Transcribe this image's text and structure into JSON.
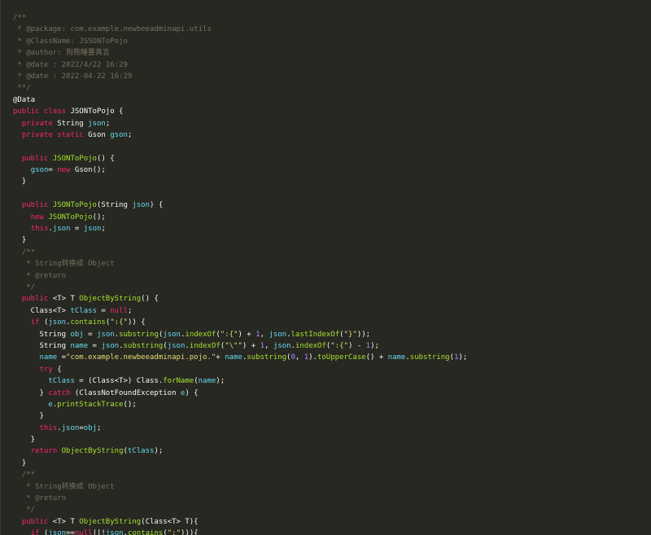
{
  "editor": {
    "lines": [
      [
        [
          "c",
          "/**"
        ]
      ],
      [
        [
          "c",
          " * @package: com.example.newbeeadminapi.utils"
        ]
      ],
      [
        [
          "c",
          " * @ClassName: JSSONToPojo"
        ]
      ],
      [
        [
          "c",
          " * @author: 狗熊睡要真言"
        ]
      ],
      [
        [
          "c",
          " * @date : 2022/4/22 16:29"
        ]
      ],
      [
        [
          "c",
          " * @date : 2022-04-22 16:29"
        ]
      ],
      [
        [
          "c",
          " **/"
        ]
      ],
      [
        [
          "a",
          "@Data"
        ]
      ],
      [
        [
          "k",
          "public class "
        ],
        [
          "p",
          "JSONToPojo {"
        ]
      ],
      [
        [
          "p",
          "  "
        ],
        [
          "k",
          "private "
        ],
        [
          "p",
          "String "
        ],
        [
          "v",
          "json"
        ],
        [
          "p",
          ";"
        ]
      ],
      [
        [
          "p",
          "  "
        ],
        [
          "k",
          "private static "
        ],
        [
          "p",
          "Gson "
        ],
        [
          "v",
          "gson"
        ],
        [
          "p",
          ";"
        ]
      ],
      [],
      [
        [
          "p",
          "  "
        ],
        [
          "k",
          "public "
        ],
        [
          "f",
          "JSONToPojo"
        ],
        [
          "p",
          "() {"
        ]
      ],
      [
        [
          "p",
          "    "
        ],
        [
          "v",
          "gson"
        ],
        [
          "p",
          "= "
        ],
        [
          "k",
          "new "
        ],
        [
          "p",
          "Gson();"
        ]
      ],
      [
        [
          "p",
          "  }"
        ]
      ],
      [],
      [
        [
          "p",
          "  "
        ],
        [
          "k",
          "public "
        ],
        [
          "f",
          "JSONToPojo"
        ],
        [
          "p",
          "(String "
        ],
        [
          "v",
          "json"
        ],
        [
          "p",
          ") {"
        ]
      ],
      [
        [
          "p",
          "    "
        ],
        [
          "k",
          "new "
        ],
        [
          "f",
          "JSONToPojo"
        ],
        [
          "p",
          "();"
        ]
      ],
      [
        [
          "p",
          "    "
        ],
        [
          "k",
          "this"
        ],
        [
          "p",
          "."
        ],
        [
          "v",
          "json"
        ],
        [
          "p",
          " = "
        ],
        [
          "v",
          "json"
        ],
        [
          "p",
          ";"
        ]
      ],
      [
        [
          "p",
          "  }"
        ]
      ],
      [
        [
          "c",
          "  /**"
        ]
      ],
      [
        [
          "c",
          "   * String转换成 Object"
        ]
      ],
      [
        [
          "c",
          "   * @return"
        ]
      ],
      [
        [
          "c",
          "   */"
        ]
      ],
      [
        [
          "p",
          "  "
        ],
        [
          "k",
          "public "
        ],
        [
          "p",
          "<T> T "
        ],
        [
          "f",
          "ObjectByString"
        ],
        [
          "p",
          "() {"
        ]
      ],
      [
        [
          "p",
          "    Class<T> "
        ],
        [
          "v",
          "tClass"
        ],
        [
          "p",
          " = "
        ],
        [
          "k",
          "null"
        ],
        [
          "p",
          ";"
        ]
      ],
      [
        [
          "p",
          "    "
        ],
        [
          "k",
          "if "
        ],
        [
          "p",
          "("
        ],
        [
          "v",
          "json"
        ],
        [
          "p",
          "."
        ],
        [
          "f",
          "contains"
        ],
        [
          "p",
          "("
        ],
        [
          "s",
          "\":{\""
        ],
        [
          "p",
          ")) {"
        ]
      ],
      [
        [
          "p",
          "      String "
        ],
        [
          "v",
          "obj"
        ],
        [
          "p",
          " = "
        ],
        [
          "v",
          "json"
        ],
        [
          "p",
          "."
        ],
        [
          "f",
          "substring"
        ],
        [
          "p",
          "("
        ],
        [
          "v",
          "json"
        ],
        [
          "p",
          "."
        ],
        [
          "f",
          "indexOf"
        ],
        [
          "p",
          "("
        ],
        [
          "s",
          "\":{\""
        ],
        [
          "p",
          ") + "
        ],
        [
          "n",
          "1"
        ],
        [
          "p",
          ", "
        ],
        [
          "v",
          "json"
        ],
        [
          "p",
          "."
        ],
        [
          "f",
          "lastIndexOf"
        ],
        [
          "p",
          "("
        ],
        [
          "s",
          "\"}\""
        ],
        [
          "p",
          "));"
        ]
      ],
      [
        [
          "p",
          "      String "
        ],
        [
          "v",
          "name"
        ],
        [
          "p",
          " = "
        ],
        [
          "v",
          "json"
        ],
        [
          "p",
          "."
        ],
        [
          "f",
          "substring"
        ],
        [
          "p",
          "("
        ],
        [
          "v",
          "json"
        ],
        [
          "p",
          "."
        ],
        [
          "f",
          "indexOf"
        ],
        [
          "p",
          "("
        ],
        [
          "s",
          "\"\\\"\""
        ],
        [
          "p",
          ") + "
        ],
        [
          "n",
          "1"
        ],
        [
          "p",
          ", "
        ],
        [
          "v",
          "json"
        ],
        [
          "p",
          "."
        ],
        [
          "f",
          "indexOf"
        ],
        [
          "p",
          "("
        ],
        [
          "s",
          "\":{\""
        ],
        [
          "p",
          ") - "
        ],
        [
          "n",
          "1"
        ],
        [
          "p",
          ");"
        ]
      ],
      [
        [
          "p",
          "      "
        ],
        [
          "v",
          "name"
        ],
        [
          "p",
          " ="
        ],
        [
          "s",
          "\"com.example.newbeeadminapi.pojo.\""
        ],
        [
          "p",
          "+ "
        ],
        [
          "v",
          "name"
        ],
        [
          "p",
          "."
        ],
        [
          "f",
          "substring"
        ],
        [
          "p",
          "("
        ],
        [
          "n",
          "0"
        ],
        [
          "p",
          ", "
        ],
        [
          "n",
          "1"
        ],
        [
          "p",
          ")."
        ],
        [
          "f",
          "toUpperCase"
        ],
        [
          "p",
          "() + "
        ],
        [
          "v",
          "name"
        ],
        [
          "p",
          "."
        ],
        [
          "f",
          "substring"
        ],
        [
          "p",
          "("
        ],
        [
          "n",
          "1"
        ],
        [
          "p",
          ");"
        ]
      ],
      [
        [
          "p",
          "      "
        ],
        [
          "k",
          "try "
        ],
        [
          "p",
          "{"
        ]
      ],
      [
        [
          "p",
          "        "
        ],
        [
          "v",
          "tClass"
        ],
        [
          "p",
          " = (Class<T>) Class."
        ],
        [
          "f",
          "forName"
        ],
        [
          "p",
          "("
        ],
        [
          "v",
          "name"
        ],
        [
          "p",
          ");"
        ]
      ],
      [
        [
          "p",
          "      } "
        ],
        [
          "k",
          "catch "
        ],
        [
          "p",
          "(ClassNotFoundException "
        ],
        [
          "v",
          "e"
        ],
        [
          "p",
          ") {"
        ]
      ],
      [
        [
          "p",
          "        "
        ],
        [
          "v",
          "e"
        ],
        [
          "p",
          "."
        ],
        [
          "f",
          "printStackTrace"
        ],
        [
          "p",
          "();"
        ]
      ],
      [
        [
          "p",
          "      }"
        ]
      ],
      [
        [
          "p",
          "      "
        ],
        [
          "k",
          "this"
        ],
        [
          "p",
          "."
        ],
        [
          "v",
          "json"
        ],
        [
          "p",
          "="
        ],
        [
          "v",
          "obj"
        ],
        [
          "p",
          ";"
        ]
      ],
      [
        [
          "p",
          "    }"
        ]
      ],
      [
        [
          "p",
          "    "
        ],
        [
          "k",
          "return "
        ],
        [
          "f",
          "ObjectByString"
        ],
        [
          "p",
          "("
        ],
        [
          "v",
          "tClass"
        ],
        [
          "p",
          ");"
        ]
      ],
      [
        [
          "p",
          "  }"
        ]
      ],
      [
        [
          "c",
          "  /**"
        ]
      ],
      [
        [
          "c",
          "   * String转换成 Object"
        ]
      ],
      [
        [
          "c",
          "   * @return"
        ]
      ],
      [
        [
          "c",
          "   */"
        ]
      ],
      [
        [
          "p",
          "  "
        ],
        [
          "k",
          "public "
        ],
        [
          "p",
          "<T> T "
        ],
        [
          "f",
          "ObjectByString"
        ],
        [
          "p",
          "(Class<T> T){"
        ]
      ],
      [
        [
          "p",
          "    "
        ],
        [
          "k",
          "if "
        ],
        [
          "p",
          "("
        ],
        [
          "v",
          "json"
        ],
        [
          "p",
          "=="
        ],
        [
          "k",
          "null"
        ],
        [
          "p",
          "||!"
        ],
        [
          "v",
          "json"
        ],
        [
          "p",
          "."
        ],
        [
          "f",
          "contains"
        ],
        [
          "p",
          "("
        ],
        [
          "s",
          "\":\""
        ],
        [
          "p",
          "))){"
        ]
      ]
    ]
  },
  "colors": {
    "background": "#272822",
    "comment": "#75715e",
    "keyword": "#f92672",
    "string": "#e6db74",
    "function": "#a6e22e",
    "variable": "#66d9ef",
    "number": "#ae81ff",
    "plain": "#f8f8f2"
  }
}
